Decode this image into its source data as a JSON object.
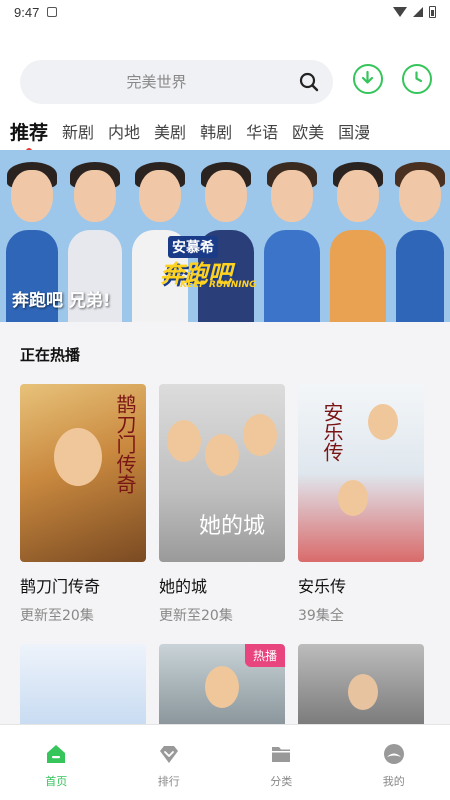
{
  "status_bar": {
    "time": "9:47"
  },
  "search": {
    "placeholder": "完美世界"
  },
  "header_buttons": {
    "download_icon": "download-circle-icon",
    "history_icon": "clock-icon"
  },
  "tabs": [
    {
      "label": "推荐",
      "active": true
    },
    {
      "label": "新剧"
    },
    {
      "label": "内地"
    },
    {
      "label": "美剧"
    },
    {
      "label": "韩剧"
    },
    {
      "label": "华语"
    },
    {
      "label": "欧美"
    },
    {
      "label": "国漫"
    }
  ],
  "banner": {
    "logo_top": "安慕希",
    "logo_main": "奔跑吧",
    "logo_sub": "KEEP RUNNING",
    "caption": "奔跑吧 兄弟!"
  },
  "section": {
    "title": "正在热播"
  },
  "cards": [
    {
      "name": "鹊刀门传奇",
      "sub": "更新至20集",
      "poster_text": "鹊刀门传奇"
    },
    {
      "name": "她的城",
      "sub": "更新至20集",
      "poster_text": "她的城"
    },
    {
      "name": "安乐传",
      "sub": "39集全",
      "poster_text": "安乐传"
    }
  ],
  "second_row": [
    {
      "poster_text": ""
    },
    {
      "badge": "热播"
    },
    {
      "poster_text": ""
    }
  ],
  "bottom_nav": [
    {
      "label": "首页",
      "icon": "home-icon",
      "active": true
    },
    {
      "label": "排行",
      "icon": "diamond-icon"
    },
    {
      "label": "分类",
      "icon": "folder-icon"
    },
    {
      "label": "我的",
      "icon": "profile-icon"
    }
  ],
  "colors": {
    "accent": "#35c55a",
    "badge": "#e8447d",
    "active_dot": "#e53935"
  }
}
